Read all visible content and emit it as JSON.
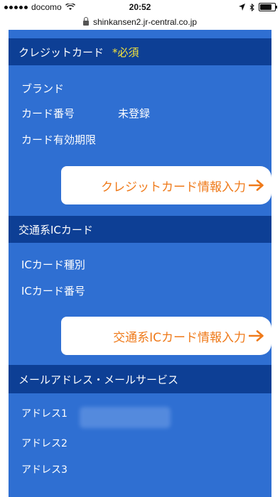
{
  "status_bar": {
    "carrier": "docomo",
    "time": "20:52",
    "battery": "battery-icon",
    "icons": [
      "signal-icon",
      "wifi-icon",
      "location-icon",
      "bluetooth-icon"
    ]
  },
  "url_bar": {
    "domain": "shinkansen2.jr-central.co.jp"
  },
  "credit_card": {
    "title": "クレジットカード",
    "required": "*必須",
    "brand_label": "ブランド",
    "number_label": "カード番号",
    "number_value": "未登録",
    "expiry_label": "カード有効期限",
    "button_label": "クレジットカード情報入力"
  },
  "ic_card": {
    "title": "交通系ICカード",
    "type_label": "ICカード種別",
    "number_label": "ICカード番号",
    "button_label": "交通系ICカード情報入力"
  },
  "mail": {
    "title": "メールアドレス・メールサービス",
    "address1_label": "アドレス1",
    "address2_label": "アドレス2",
    "address3_label": "アドレス3"
  },
  "colors": {
    "panel": "#2f6fd2",
    "header": "#0d3f95",
    "accent_orange": "#ef7a1a",
    "required_yellow": "#f3e33d"
  }
}
